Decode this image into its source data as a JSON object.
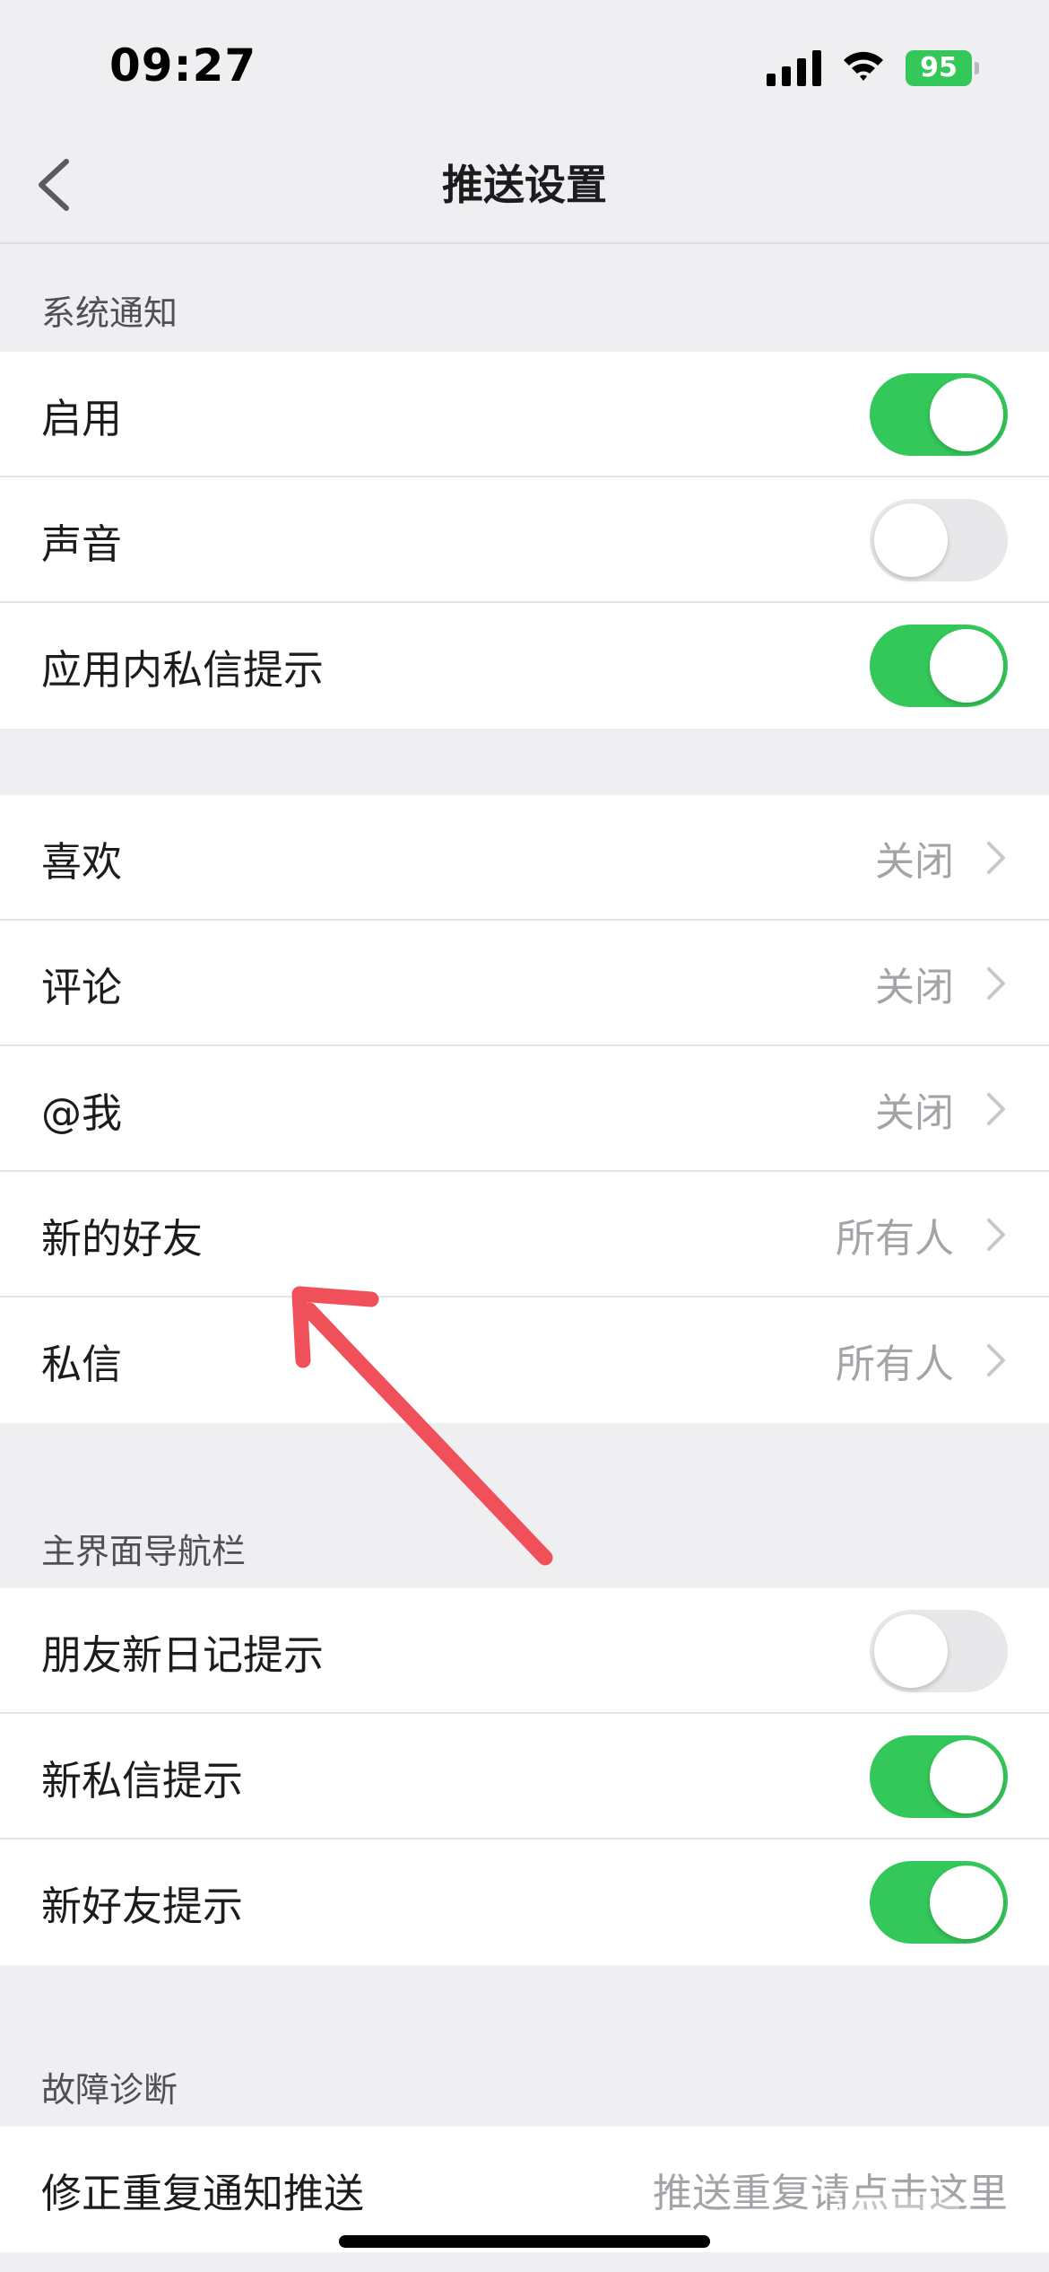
{
  "status_bar": {
    "time": "09:27",
    "battery": "95",
    "battery_color": "#34c759"
  },
  "nav": {
    "title": "推送设置",
    "back_icon": "chevron-left-icon"
  },
  "sections": {
    "system": {
      "header": "系统通知",
      "rows": [
        {
          "label": "启用",
          "toggle": true
        },
        {
          "label": "声音",
          "toggle": false
        },
        {
          "label": "应用内私信提示",
          "toggle": true
        }
      ]
    },
    "interactions": {
      "rows": [
        {
          "label": "喜欢",
          "value": "关闭"
        },
        {
          "label": "评论",
          "value": "关闭"
        },
        {
          "label": "@我",
          "value": "关闭"
        },
        {
          "label": "新的好友",
          "value": "所有人"
        },
        {
          "label": "私信",
          "value": "所有人"
        }
      ]
    },
    "main_nav": {
      "header": "主界面导航栏",
      "rows": [
        {
          "label": "朋友新日记提示",
          "toggle": false
        },
        {
          "label": "新私信提示",
          "toggle": true
        },
        {
          "label": "新好友提示",
          "toggle": true
        }
      ]
    },
    "diagnosis": {
      "header": "故障诊断",
      "rows": [
        {
          "label": "修正重复通知推送",
          "value": "推送重复请点击这里"
        }
      ]
    }
  },
  "colors": {
    "toggle_on": "#34c759",
    "toggle_off": "#e8e8ea",
    "annotation": "#f0505a"
  }
}
